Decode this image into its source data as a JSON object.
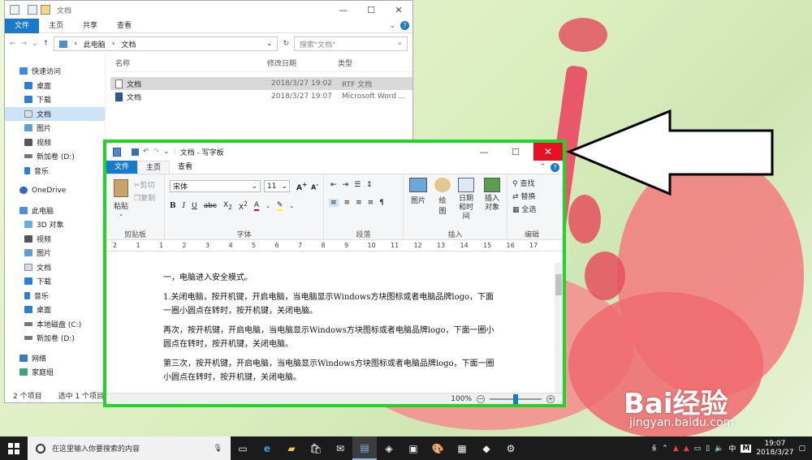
{
  "explorer": {
    "title": "文档",
    "tabs": [
      "文件",
      "主页",
      "共享",
      "查看"
    ],
    "address": {
      "root": "此电脑",
      "current": "文档"
    },
    "search_placeholder": "搜索\"文档\"",
    "columns": {
      "name": "名称",
      "date": "修改日期",
      "type": "类型"
    },
    "files": [
      {
        "name": "文档",
        "date": "2018/3/27 19:02",
        "type": "RTF 文档"
      },
      {
        "name": "文档",
        "date": "2018/3/27 19:07",
        "type": "Microsoft Word ..."
      }
    ],
    "nav": [
      "快速访问",
      "桌面",
      "下载",
      "文档",
      "图片",
      "视频",
      "新加卷 (D:)",
      "音乐",
      "OneDrive",
      "此电脑",
      "3D 对象",
      "视频",
      "图片",
      "文档",
      "下载",
      "音乐",
      "桌面",
      "本地磁盘 (C:)",
      "新加卷 (D:)",
      "网络",
      "家庭组"
    ],
    "status_count": "2 个项目",
    "status_selected": "选中 1 个项目"
  },
  "wordpad": {
    "title": "文档 - 写字板",
    "tabs": [
      "文件",
      "主页",
      "查看"
    ],
    "clipboard": {
      "paste": "粘贴",
      "cut": "剪切",
      "copy": "复制",
      "label": "剪贴板"
    },
    "font": {
      "name": "宋体",
      "size": "11",
      "label": "字体"
    },
    "paragraph_label": "段落",
    "insert": {
      "picture": "图片",
      "paint": "绘图",
      "datetime": "日期和时间",
      "object": "插入对象",
      "label": "插入"
    },
    "edit": {
      "find": "查找",
      "replace": "替换",
      "select_all": "全选",
      "label": "编辑"
    },
    "ruler": [
      "2",
      "1",
      "1",
      "2",
      "3",
      "4",
      "5",
      "6",
      "7",
      "8",
      "9",
      "10",
      "11",
      "12",
      "13",
      "14",
      "15",
      "16",
      "17"
    ],
    "paragraphs": [
      "一，电脑进入安全模式。",
      "1.关闭电脑，按开机键，开启电脑，当电脑显示Windows方块图标或者电脑品牌logo，下面一圈小圆点在转时，按开机键，关闭电脑。",
      "再次，按开机键，开启电脑，当电脑显示Windows方块图标或者电脑品牌logo，下面一圈小圆点在转时，按开机键，关闭电脑。",
      "第三次，按开机键，开启电脑，当电脑显示Windows方块图标或者电脑品牌logo，下面一圈小圆点在转时，按开机键，关闭电脑。"
    ],
    "zoom": "100%",
    "zoom_level": 0.5
  },
  "taskbar": {
    "search_placeholder": "在这里输入你要搜索的内容",
    "time": "19:07",
    "date": "2018/3/27",
    "ime": "中",
    "ime_mode": "M"
  },
  "watermark": {
    "text": "Bai经验",
    "url": "jingyan.baidu.com"
  },
  "colors": {
    "accent": "#1979ca",
    "highlight_border": "#22d42a",
    "close_red": "#e81123"
  }
}
